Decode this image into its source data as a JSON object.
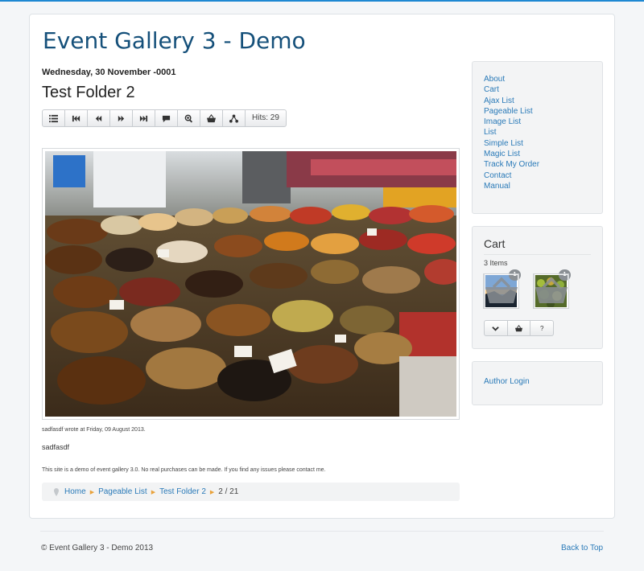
{
  "site": {
    "title": "Event Gallery 3 - Demo"
  },
  "event": {
    "date": "Wednesday, 30 November -0001",
    "folder_title": "Test Folder 2",
    "hits_label": "Hits: 29"
  },
  "toolbar_icons": [
    "list-icon",
    "first-icon",
    "previous-icon",
    "next-icon",
    "last-icon",
    "comment-icon",
    "zoom-icon",
    "basket-icon",
    "share-icon"
  ],
  "image": {
    "subject": "market-spices-photo"
  },
  "caption": {
    "meta": "sadfasdf wrote at Friday, 09 August 2013.",
    "text": "sadfasdf"
  },
  "note": "This site is a demo of event gallery 3.0. No real purchases can be made. If you find any issues please contact me.",
  "breadcrumb": {
    "items": [
      "Home",
      "Pageable List",
      "Test Folder 2"
    ],
    "current": "2 / 21"
  },
  "menu": {
    "items": [
      "About",
      "Cart",
      "Ajax List",
      "Pageable List",
      "Image List",
      "List",
      "Simple List",
      "Magic List",
      "Track My Order",
      "Contact",
      "Manual"
    ]
  },
  "cart": {
    "title": "Cart",
    "count_label": "3 Items",
    "items": [
      {
        "badge": "1"
      },
      {
        "badge": "1"
      }
    ],
    "actions": {
      "details_label": "?"
    }
  },
  "login": {
    "label": "Author Login"
  },
  "footer": {
    "copyright": "© Event Gallery 3 - Demo 2013",
    "back_to_top": "Back to Top"
  },
  "colors": {
    "accent": "#1e88d2",
    "title": "#15507a",
    "link": "#2a7ab8",
    "breadcrumb_separator": "#e9a23b"
  }
}
